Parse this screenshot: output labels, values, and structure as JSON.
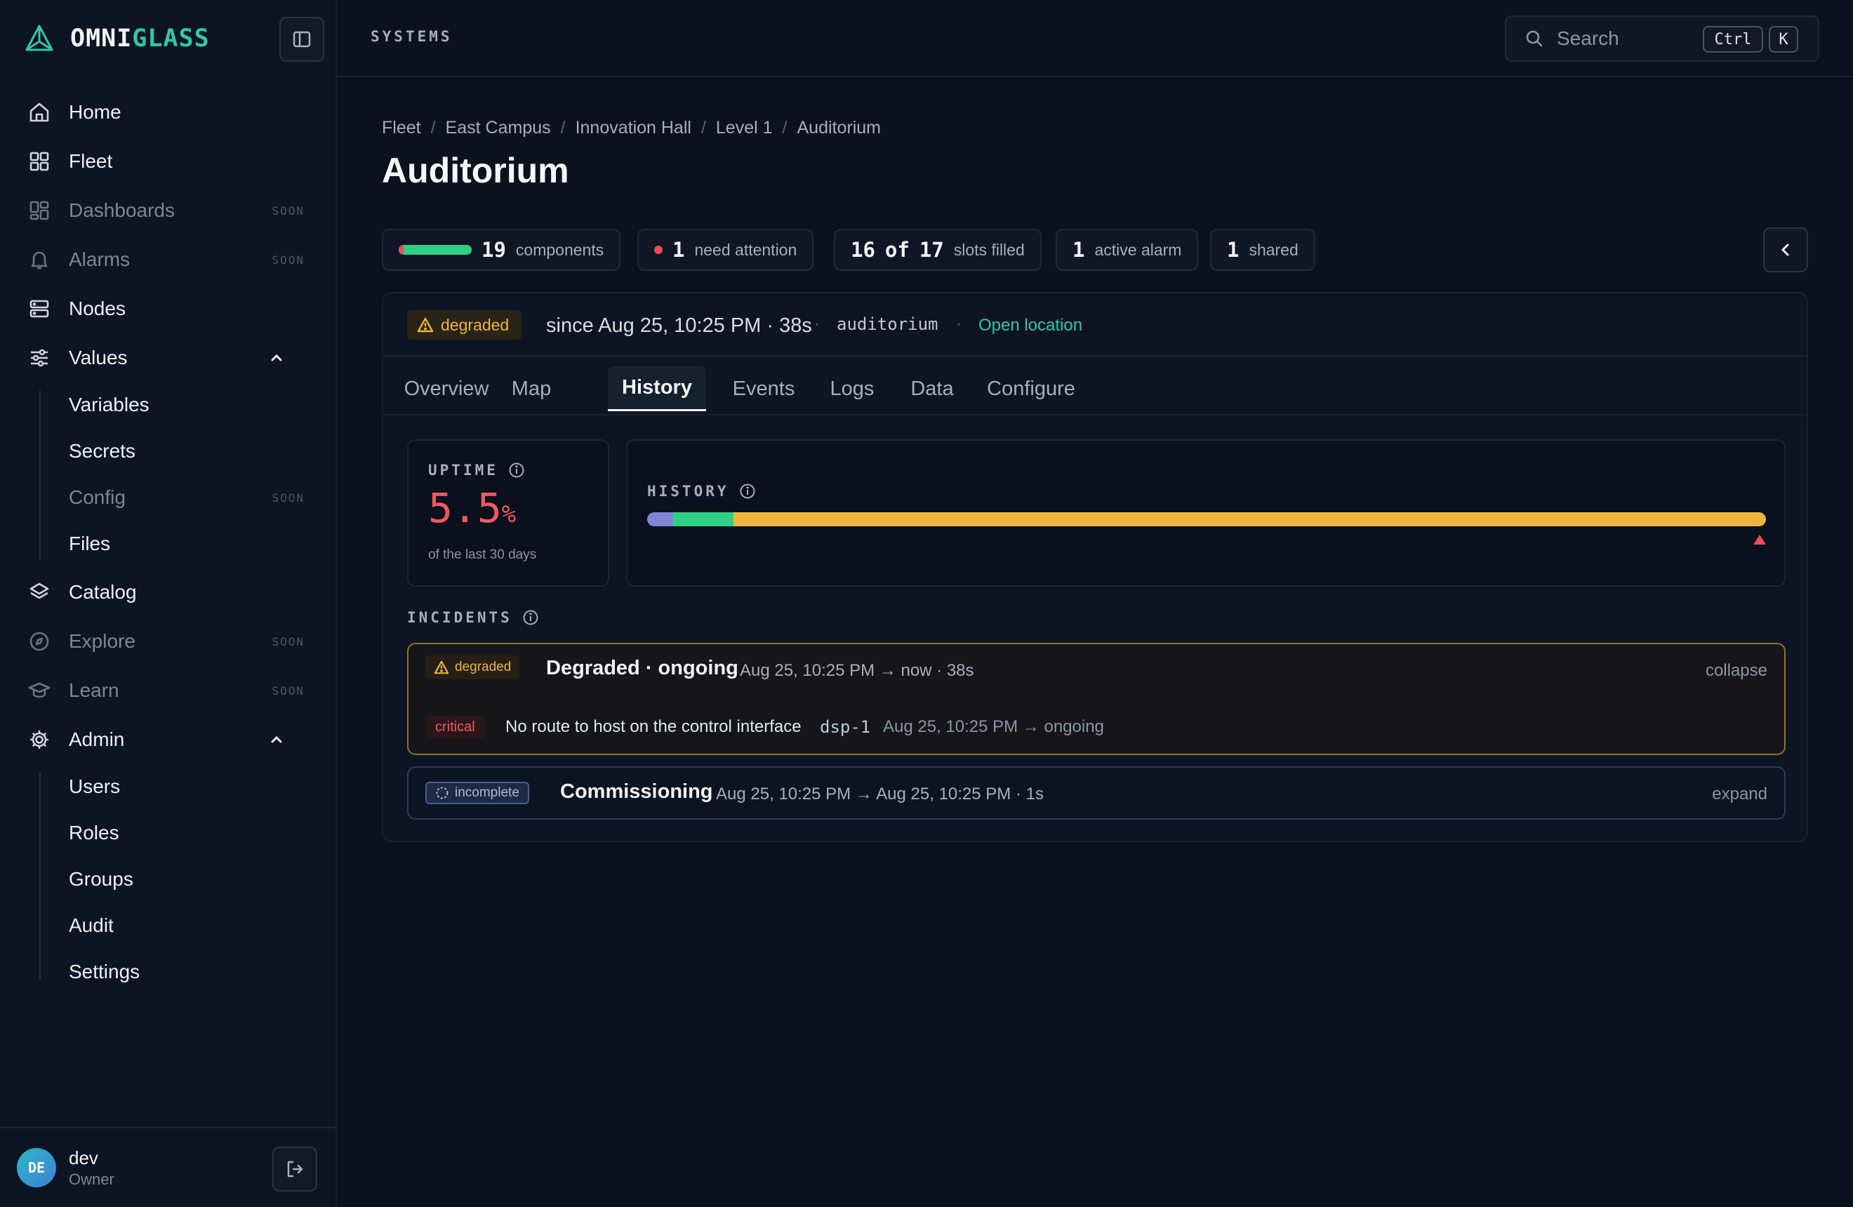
{
  "brand": {
    "part1": "OMNI",
    "part2": "GLASS"
  },
  "nav": {
    "home": "Home",
    "fleet": "Fleet",
    "dashboards": "Dashboards",
    "alarms": "Alarms",
    "nodes": "Nodes",
    "values": "Values",
    "values_sub": {
      "variables": "Variables",
      "secrets": "Secrets",
      "config": "Config",
      "files": "Files"
    },
    "catalog": "Catalog",
    "explore": "Explore",
    "learn": "Learn",
    "admin": "Admin",
    "admin_sub": {
      "users": "Users",
      "roles": "Roles",
      "groups": "Groups",
      "audit": "Audit",
      "settings": "Settings"
    },
    "soon": "SOON"
  },
  "user": {
    "initials": "DE",
    "name": "dev",
    "role": "Owner"
  },
  "topbar": {
    "section": "SYSTEMS",
    "search_placeholder": "Search",
    "shortcut_mod": "Ctrl",
    "shortcut_key": "K"
  },
  "breadcrumb": [
    "Fleet",
    "East Campus",
    "Innovation Hall",
    "Level 1",
    "Auditorium"
  ],
  "page_title": "Auditorium",
  "stats": {
    "components_count": "19",
    "components_label": "components",
    "components_health": 0.93,
    "attention_count": "1",
    "attention_label": "need attention",
    "slots_filled": "16",
    "slots_of": "of",
    "slots_total": "17",
    "slots_label": "slots filled",
    "alarm_count": "1",
    "alarm_label": "active alarm",
    "shared_count": "1",
    "shared_label": "shared"
  },
  "status": {
    "state": "degraded",
    "since": "since Aug 25, 10:25 PM · 38s",
    "dot": "·",
    "location_code": "auditorium",
    "open_location": "Open location"
  },
  "tabs": [
    "Overview",
    "Map",
    "History",
    "Events",
    "Logs",
    "Data",
    "Configure"
  ],
  "active_tab": "History",
  "uptime": {
    "label": "UPTIME",
    "value": "5.5",
    "unit": "%",
    "subtitle": "of the last 30 days"
  },
  "history": {
    "label": "HISTORY",
    "segments": [
      {
        "state": "commissioning",
        "fraction": 0.023,
        "color": "#7f86d6"
      },
      {
        "state": "healthy",
        "fraction": 0.054,
        "color": "#2fcf86"
      },
      {
        "state": "degraded",
        "fraction": 0.923,
        "color": "#f0b43a"
      }
    ]
  },
  "incidents": {
    "label": "INCIDENTS",
    "items": [
      {
        "badge": "degraded",
        "title": "Degraded · ongoing",
        "time": "Aug 25, 10:25 PM → now · 38s",
        "action": "collapse",
        "events": [
          {
            "severity": "critical",
            "message": "No route to host on the control interface",
            "node": "dsp-1",
            "time": "Aug 25, 10:25 PM → ongoing"
          }
        ]
      },
      {
        "badge": "incomplete",
        "title": "Commissioning",
        "time": "Aug 25, 10:25 PM → Aug 25, 10:25 PM · 1s",
        "action": "expand"
      }
    ]
  },
  "colors": {
    "accent": "#2fc9a4",
    "degraded": "#f0b43a",
    "critical": "#ef5a5f",
    "healthy": "#2fcf86"
  }
}
